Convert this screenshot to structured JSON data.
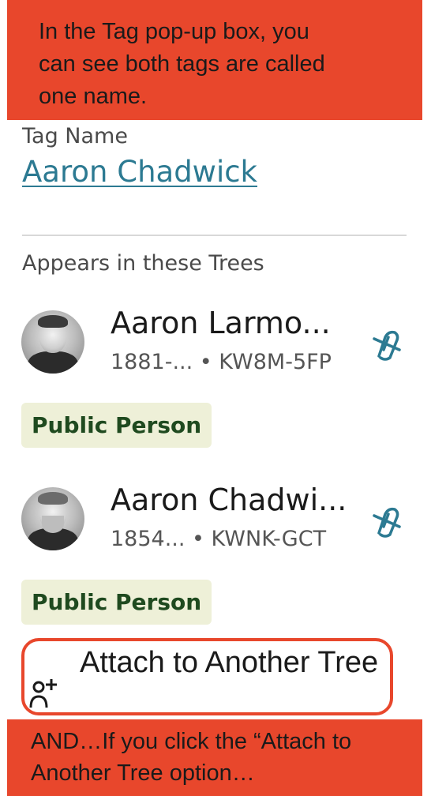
{
  "annotation_top": {
    "lines": [
      "In the Tag pop-up box, you",
      "can see both tags are called",
      "one name."
    ]
  },
  "tag": {
    "label": "Tag Name",
    "name": "Aaron Chadwick"
  },
  "section": {
    "title": "Appears in these Trees"
  },
  "persons": [
    {
      "name": "Aaron Larmo...",
      "meta": "1881-... • KW8M-5FP",
      "badge": "Public Person",
      "avatar": "photo-young-man",
      "action_icon": "unlink-icon"
    },
    {
      "name": "Aaron Chadwi...",
      "meta": "1854...  • KWNK-GCT",
      "badge": "Public Person",
      "avatar": "photo-bearded-man",
      "action_icon": "unlink-icon"
    }
  ],
  "attach": {
    "label": "Attach to Another Tree",
    "icon": "add-person-icon"
  },
  "annotation_bottom": {
    "lines": [
      "AND…If you click the “Attach to",
      "Another Tree option…"
    ]
  },
  "colors": {
    "annotation": "#e8472c",
    "link": "#2c7a92",
    "badge_bg": "#eef0d8",
    "badge_text": "#1f4a1f"
  }
}
